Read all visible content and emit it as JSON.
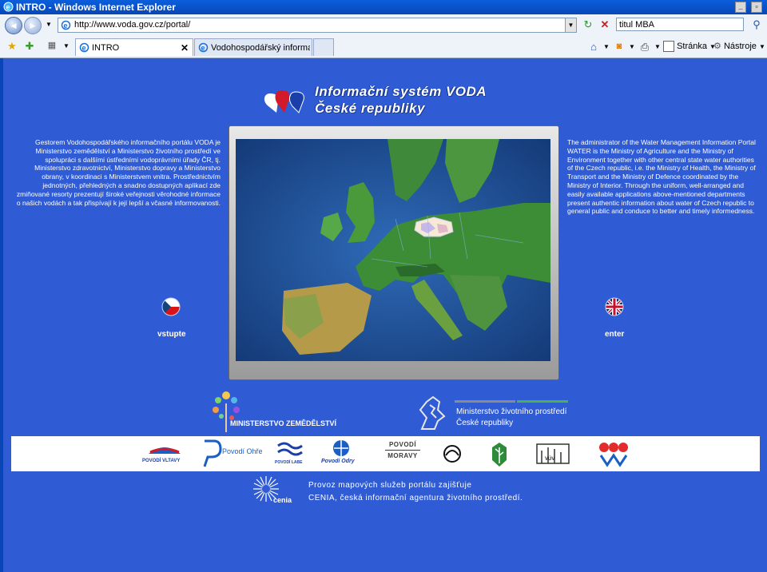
{
  "window": {
    "title": "INTRO - Windows Internet Explorer"
  },
  "address": {
    "url": "http://www.voda.gov.cz/portal/",
    "search_value": "titul MBA"
  },
  "tabs": [
    {
      "label": "INTRO"
    },
    {
      "label": "Vodohospodářský informační..."
    }
  ],
  "commands": {
    "page": "Stránka",
    "tools": "Nástroje"
  },
  "header": {
    "line1": "Informační systém VODA",
    "line2": "České republiky"
  },
  "cz_text": "Gestorem Vodohospodářského informačního portálu VODA je Ministerstvo zemědělství a Ministerstvo životního prostředí ve spolupráci s dalšími ústředními vodoprávními úřady ČR, tj. Ministerstvo zdravotnictví, Ministerstvo dopravy a Ministerstvo obrany, v koordinaci s Ministerstvem vnitra. Prostřednictvím jednotných, přehledných a snadno dostupných aplikací zde zmiňované resorty prezentují široké veřejnosti věrohodné informace o našich vodách a tak přispívají k její lepší a včasné informovanosti.",
  "en_text": "The administrator of the Water Management Information Portal WATER is the Ministry of Agriculture and the Ministry of Environment together with other central state water authorities of the Czech republic, i.e. the Ministry of Health, the Ministry of Transport and the Ministry of Defence coordinated by the Ministry of Interior. Through the uniform, well-arranged and easily available applications above-mentioned departments present authentic information about water of Czech republic to general public and conduce to better and timely informedness.",
  "entry": {
    "cz": "vstupte",
    "en": "enter"
  },
  "ministries": {
    "mz": "MINISTERSTVO ZEMĚDĚLSTVÍ",
    "mzp_line1": "Ministerstvo životního prostředí",
    "mzp_line2": "České republiky"
  },
  "partners": [
    "POVODÍ VLTAVY",
    "Povodí Ohře",
    "POVODÍ LABE",
    "Povodí Odry",
    "POVODÍ",
    "MORAVY",
    "VÚV"
  ],
  "footer": {
    "line1": "Provoz mapových služeb portálu zajišťuje",
    "line2": "CENIA, česká informační agentura životního prostředí.",
    "cenia": "cenia"
  },
  "colors": {
    "page_bg": "#2f5bd5",
    "title_bar": "#0a5fdc"
  }
}
